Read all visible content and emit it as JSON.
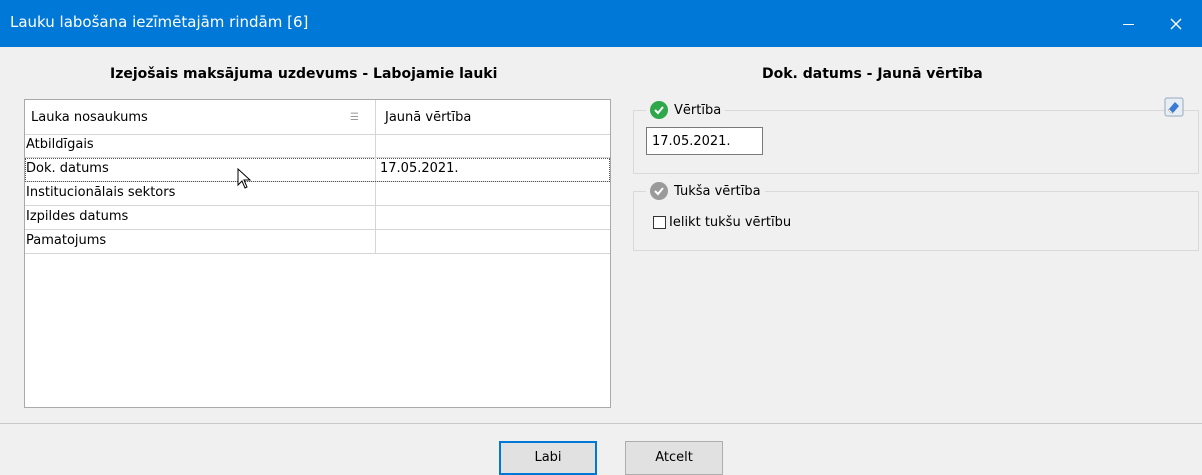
{
  "window": {
    "title": "Lauku labošana iezīmētajām rindām [6]",
    "accent": "#0078d7"
  },
  "left_panel": {
    "title": "Izejošais maksājuma uzdevums - Labojamie lauki",
    "columns": [
      "Lauka nosaukums",
      "Jaunā vērtība"
    ],
    "rows": [
      {
        "name": "Atbildīgais",
        "value": ""
      },
      {
        "name": "Dok. datums",
        "value": "17.05.2021."
      },
      {
        "name": "Institucionālais sektors",
        "value": ""
      },
      {
        "name": "Izpildes datums",
        "value": ""
      },
      {
        "name": "Pamatojums",
        "value": ""
      }
    ],
    "selected_row": 1
  },
  "right_panel": {
    "title": "Dok. datums - Jaunā vērtība",
    "value_group": {
      "label": "Vērtība",
      "value": "17.05.2021.",
      "icon": "check-circle-icon",
      "icon_color": "#2ea84a"
    },
    "empty_group": {
      "label": "Tukša vērtība",
      "checkbox_label": "Ielikt tukšu vērtību",
      "checked": false,
      "icon": "check-circle-icon",
      "icon_color": "#9a9a9a"
    }
  },
  "buttons": {
    "ok": "Labi",
    "cancel": "Atcelt"
  }
}
